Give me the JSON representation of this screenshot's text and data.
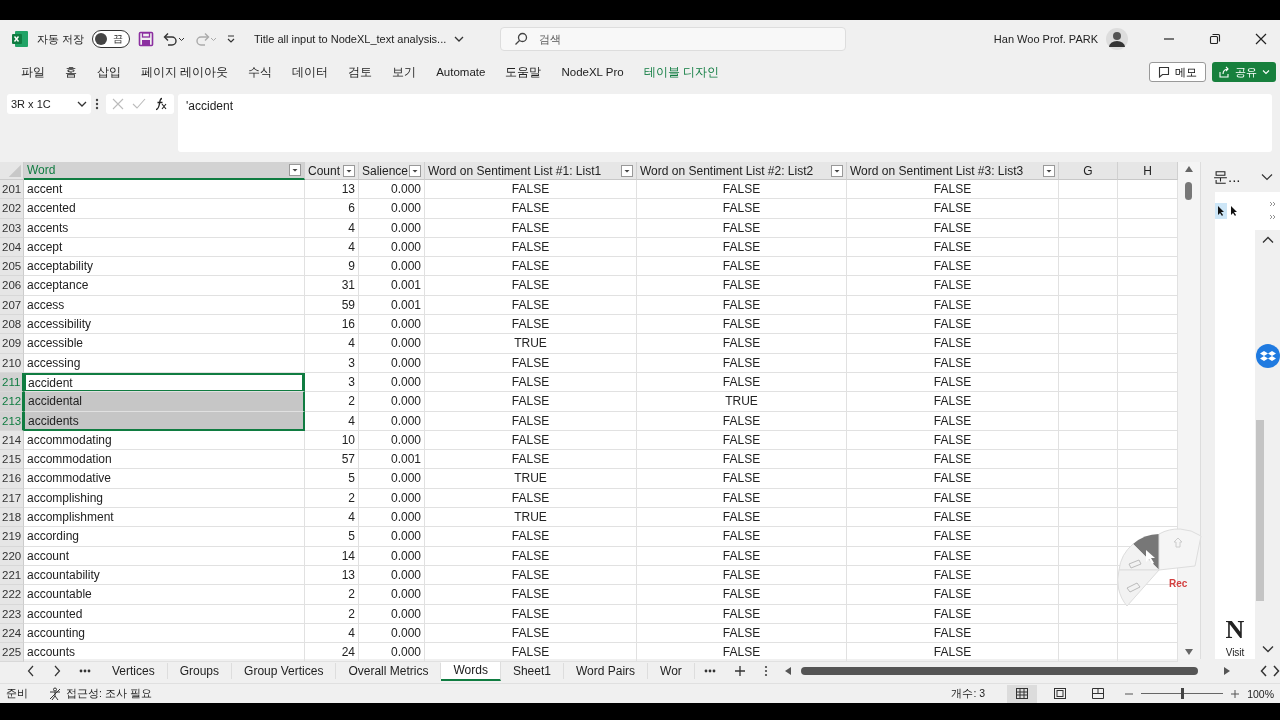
{
  "titlebar": {
    "autosave_label": "자동 저장",
    "autosave": {
      "on": false,
      "label": "끔"
    },
    "document_title": "Title all input to NodeXL_text analysis...",
    "search": {
      "placeholder": "검색"
    },
    "user_name": "Han Woo Prof. PARK"
  },
  "ribbon_tabs": [
    {
      "label": "파일",
      "kind": "normal"
    },
    {
      "label": "홈",
      "kind": "normal"
    },
    {
      "label": "삽입",
      "kind": "normal"
    },
    {
      "label": "페이지 레이아웃",
      "kind": "normal"
    },
    {
      "label": "수식",
      "kind": "normal"
    },
    {
      "label": "데이터",
      "kind": "normal"
    },
    {
      "label": "검토",
      "kind": "normal"
    },
    {
      "label": "보기",
      "kind": "normal"
    },
    {
      "label": "Automate",
      "kind": "normal"
    },
    {
      "label": "도움말",
      "kind": "normal"
    },
    {
      "label": "NodeXL Pro",
      "kind": "normal"
    },
    {
      "label": "테이블 디자인",
      "kind": "contextual"
    }
  ],
  "ribbon_buttons": {
    "comments": "메모",
    "share": "공유"
  },
  "formula_bar": {
    "name_box": "3R x 1C",
    "formula": "'accident"
  },
  "table": {
    "columns": [
      {
        "label": "Word",
        "filter": true,
        "selected": true
      },
      {
        "label": "Count",
        "filter": true,
        "selected": false
      },
      {
        "label": "Salience",
        "filter": true,
        "selected": false
      },
      {
        "label": "Word on Sentiment List #1: List1",
        "filter": true,
        "selected": false
      },
      {
        "label": "Word on Sentiment List #2: List2",
        "filter": true,
        "selected": false
      },
      {
        "label": "Word on Sentiment List #3: List3",
        "filter": true,
        "selected": false
      },
      {
        "label": "G",
        "filter": false,
        "selected": false
      },
      {
        "label": "H",
        "filter": false,
        "selected": false
      }
    ],
    "rows": [
      {
        "row": "201",
        "word": "accent",
        "count": "13",
        "salience": "0.000",
        "lists": [
          "FALSE",
          "FALSE",
          "FALSE"
        ],
        "selected": false,
        "active": false
      },
      {
        "row": "202",
        "word": "accented",
        "count": "6",
        "salience": "0.000",
        "lists": [
          "FALSE",
          "FALSE",
          "FALSE"
        ],
        "selected": false,
        "active": false
      },
      {
        "row": "203",
        "word": "accents",
        "count": "4",
        "salience": "0.000",
        "lists": [
          "FALSE",
          "FALSE",
          "FALSE"
        ],
        "selected": false,
        "active": false
      },
      {
        "row": "204",
        "word": "accept",
        "count": "4",
        "salience": "0.000",
        "lists": [
          "FALSE",
          "FALSE",
          "FALSE"
        ],
        "selected": false,
        "active": false
      },
      {
        "row": "205",
        "word": "acceptability",
        "count": "9",
        "salience": "0.000",
        "lists": [
          "FALSE",
          "FALSE",
          "FALSE"
        ],
        "selected": false,
        "active": false
      },
      {
        "row": "206",
        "word": "acceptance",
        "count": "31",
        "salience": "0.001",
        "lists": [
          "FALSE",
          "FALSE",
          "FALSE"
        ],
        "selected": false,
        "active": false
      },
      {
        "row": "207",
        "word": "access",
        "count": "59",
        "salience": "0.001",
        "lists": [
          "FALSE",
          "FALSE",
          "FALSE"
        ],
        "selected": false,
        "active": false
      },
      {
        "row": "208",
        "word": "accessibility",
        "count": "16",
        "salience": "0.000",
        "lists": [
          "FALSE",
          "FALSE",
          "FALSE"
        ],
        "selected": false,
        "active": false
      },
      {
        "row": "209",
        "word": "accessible",
        "count": "4",
        "salience": "0.000",
        "lists": [
          "TRUE",
          "FALSE",
          "FALSE"
        ],
        "selected": false,
        "active": false
      },
      {
        "row": "210",
        "word": "accessing",
        "count": "3",
        "salience": "0.000",
        "lists": [
          "FALSE",
          "FALSE",
          "FALSE"
        ],
        "selected": false,
        "active": false
      },
      {
        "row": "211",
        "word": "accident",
        "count": "3",
        "salience": "0.000",
        "lists": [
          "FALSE",
          "FALSE",
          "FALSE"
        ],
        "selected": true,
        "active": true
      },
      {
        "row": "212",
        "word": "accidental",
        "count": "2",
        "salience": "0.000",
        "lists": [
          "FALSE",
          "TRUE",
          "FALSE"
        ],
        "selected": true,
        "active": false
      },
      {
        "row": "213",
        "word": "accidents",
        "count": "4",
        "salience": "0.000",
        "lists": [
          "FALSE",
          "FALSE",
          "FALSE"
        ],
        "selected": true,
        "active": false
      },
      {
        "row": "214",
        "word": "accommodating",
        "count": "10",
        "salience": "0.000",
        "lists": [
          "FALSE",
          "FALSE",
          "FALSE"
        ],
        "selected": false,
        "active": false
      },
      {
        "row": "215",
        "word": "accommodation",
        "count": "57",
        "salience": "0.001",
        "lists": [
          "FALSE",
          "FALSE",
          "FALSE"
        ],
        "selected": false,
        "active": false
      },
      {
        "row": "216",
        "word": "accommodative",
        "count": "5",
        "salience": "0.000",
        "lists": [
          "TRUE",
          "FALSE",
          "FALSE"
        ],
        "selected": false,
        "active": false
      },
      {
        "row": "217",
        "word": "accomplishing",
        "count": "2",
        "salience": "0.000",
        "lists": [
          "FALSE",
          "FALSE",
          "FALSE"
        ],
        "selected": false,
        "active": false
      },
      {
        "row": "218",
        "word": "accomplishment",
        "count": "4",
        "salience": "0.000",
        "lists": [
          "TRUE",
          "FALSE",
          "FALSE"
        ],
        "selected": false,
        "active": false
      },
      {
        "row": "219",
        "word": "according",
        "count": "5",
        "salience": "0.000",
        "lists": [
          "FALSE",
          "FALSE",
          "FALSE"
        ],
        "selected": false,
        "active": false
      },
      {
        "row": "220",
        "word": "account",
        "count": "14",
        "salience": "0.000",
        "lists": [
          "FALSE",
          "FALSE",
          "FALSE"
        ],
        "selected": false,
        "active": false
      },
      {
        "row": "221",
        "word": "accountability",
        "count": "13",
        "salience": "0.000",
        "lists": [
          "FALSE",
          "FALSE",
          "FALSE"
        ],
        "selected": false,
        "active": false
      },
      {
        "row": "222",
        "word": "accountable",
        "count": "2",
        "salience": "0.000",
        "lists": [
          "FALSE",
          "FALSE",
          "FALSE"
        ],
        "selected": false,
        "active": false
      },
      {
        "row": "223",
        "word": "accounted",
        "count": "2",
        "salience": "0.000",
        "lists": [
          "FALSE",
          "FALSE",
          "FALSE"
        ],
        "selected": false,
        "active": false
      },
      {
        "row": "224",
        "word": "accounting",
        "count": "4",
        "salience": "0.000",
        "lists": [
          "FALSE",
          "FALSE",
          "FALSE"
        ],
        "selected": false,
        "active": false
      },
      {
        "row": "225",
        "word": "accounts",
        "count": "24",
        "salience": "0.000",
        "lists": [
          "FALSE",
          "FALSE",
          "FALSE"
        ],
        "selected": false,
        "active": false
      }
    ]
  },
  "side_pane": {
    "title": "문...",
    "big_letter": "N",
    "link": "Visit"
  },
  "recorder": {
    "label": "Rec"
  },
  "sheet_tabs": [
    {
      "label": "Vertices",
      "selected": false
    },
    {
      "label": "Groups",
      "selected": false
    },
    {
      "label": "Group Vertices",
      "selected": false
    },
    {
      "label": "Overall Metrics",
      "selected": false
    },
    {
      "label": "Words",
      "selected": true
    },
    {
      "label": "Sheet1",
      "selected": false
    },
    {
      "label": "Word Pairs",
      "selected": false
    },
    {
      "label": "Wor",
      "selected": false
    }
  ],
  "status_bar": {
    "ready": "준비",
    "accessibility": "접근성: 조사 필요",
    "count": "개수: 3",
    "views": [
      {
        "kind": "normal",
        "selected": true
      },
      {
        "kind": "page_layout",
        "selected": false
      },
      {
        "kind": "page_break",
        "selected": false
      }
    ],
    "zoom": {
      "level": 0.5,
      "label": "100%"
    }
  }
}
